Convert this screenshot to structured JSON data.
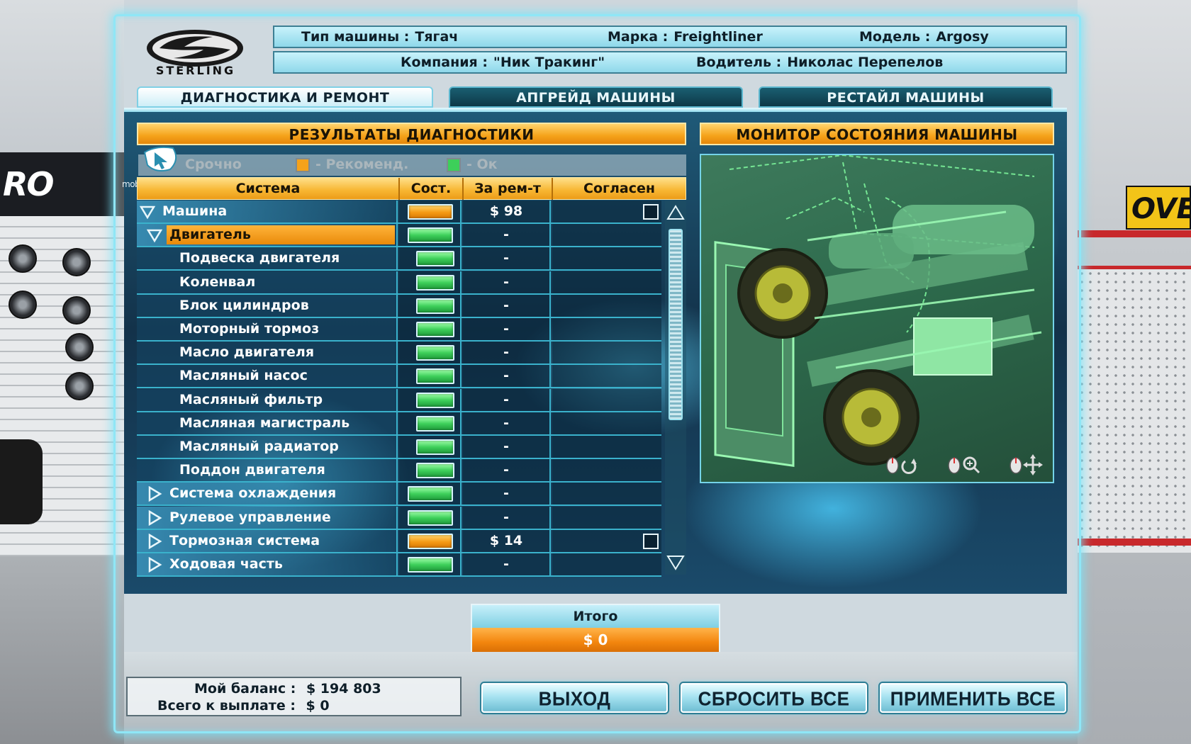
{
  "header": {
    "logo_text": "STERLING",
    "vehicle_type_label": "Тип машины :",
    "vehicle_type_value": "Тягач",
    "brand_label": "Марка :",
    "brand_value": "Freightliner",
    "model_label": "Модель :",
    "model_value": "Argosy",
    "company_label": "Компания :",
    "company_value": "\"Ник Тракинг\"",
    "driver_label": "Водитель :",
    "driver_value": "Николас Перепелов"
  },
  "tabs": [
    {
      "label": "ДИАГНОСТИКА И РЕМОНТ",
      "active": true
    },
    {
      "label": "АПГРЕЙД МАШИНЫ",
      "active": false
    },
    {
      "label": "РЕСТАЙЛ МАШИНЫ",
      "active": false
    }
  ],
  "diagnostics": {
    "title": "РЕЗУЛЬТАТЫ ДИАГНОСТИКИ",
    "legend": {
      "urgent": "Срочно",
      "recommended": "- Рекоменд.",
      "ok": "- Ок"
    },
    "watermark": "mobile-review.com",
    "columns": [
      "Система",
      "Сост.",
      "За рем-т",
      "Согласен"
    ],
    "rows": [
      {
        "name": "Машина",
        "level": 0,
        "expander": "open",
        "state": "warn",
        "cost": "$ 98",
        "checkbox": true
      },
      {
        "name": "Двигатель",
        "level": 1,
        "expander": "open",
        "state": "ok",
        "cost": "-",
        "checkbox": false,
        "selected": true
      },
      {
        "name": "Подвеска двигателя",
        "level": 2,
        "state": "ok",
        "cost": "-",
        "checkbox": false
      },
      {
        "name": "Коленвал",
        "level": 2,
        "state": "ok",
        "cost": "-",
        "checkbox": false
      },
      {
        "name": "Блок цилиндров",
        "level": 2,
        "state": "ok",
        "cost": "-",
        "checkbox": false
      },
      {
        "name": "Моторный тормоз",
        "level": 2,
        "state": "ok",
        "cost": "-",
        "checkbox": false
      },
      {
        "name": "Масло двигателя",
        "level": 2,
        "state": "ok",
        "cost": "-",
        "checkbox": false
      },
      {
        "name": "Масляный насос",
        "level": 2,
        "state": "ok",
        "cost": "-",
        "checkbox": false
      },
      {
        "name": "Масляный фильтр",
        "level": 2,
        "state": "ok",
        "cost": "-",
        "checkbox": false
      },
      {
        "name": "Масляная магистраль",
        "level": 2,
        "state": "ok",
        "cost": "-",
        "checkbox": false
      },
      {
        "name": "Масляный радиатор",
        "level": 2,
        "state": "ok",
        "cost": "-",
        "checkbox": false
      },
      {
        "name": "Поддон двигателя",
        "level": 2,
        "state": "ok",
        "cost": "-",
        "checkbox": false
      },
      {
        "name": "Система охлаждения",
        "level": 1,
        "expander": "closed",
        "state": "ok",
        "cost": "-",
        "checkbox": false
      },
      {
        "name": "Рулевое управление",
        "level": 1,
        "expander": "closed",
        "state": "ok",
        "cost": "-",
        "checkbox": false
      },
      {
        "name": "Тормозная система",
        "level": 1,
        "expander": "closed",
        "state": "warn",
        "cost": "$ 14",
        "checkbox": true
      },
      {
        "name": "Ходовая часть",
        "level": 1,
        "expander": "closed",
        "state": "ok",
        "cost": "-",
        "checkbox": false
      }
    ]
  },
  "monitor": {
    "title": "МОНИТОР СОСТОЯНИЯ МАШИНЫ",
    "controls": [
      "rotate-icon",
      "zoom-icon",
      "move-icon"
    ]
  },
  "total": {
    "label": "Итого",
    "value": "$ 0"
  },
  "balance": {
    "balance_label": "Мой баланс :",
    "balance_value": "$ 194 803",
    "due_label": "Всего к выплате :",
    "due_value": "$ 0"
  },
  "buttons": {
    "exit": "ВЫХОД",
    "reset": "СБРОСИТЬ ВСЕ",
    "apply": "ПРИМЕНИТЬ ВСЕ"
  },
  "scenery": {
    "left_banner": "RO RUCK",
    "right_sign": "OVE"
  },
  "colors": {
    "ok": "#3dcf5a",
    "warn": "#f59a14",
    "header_orange": "#f5a21a",
    "accent_cyan": "#8fe6f6"
  }
}
